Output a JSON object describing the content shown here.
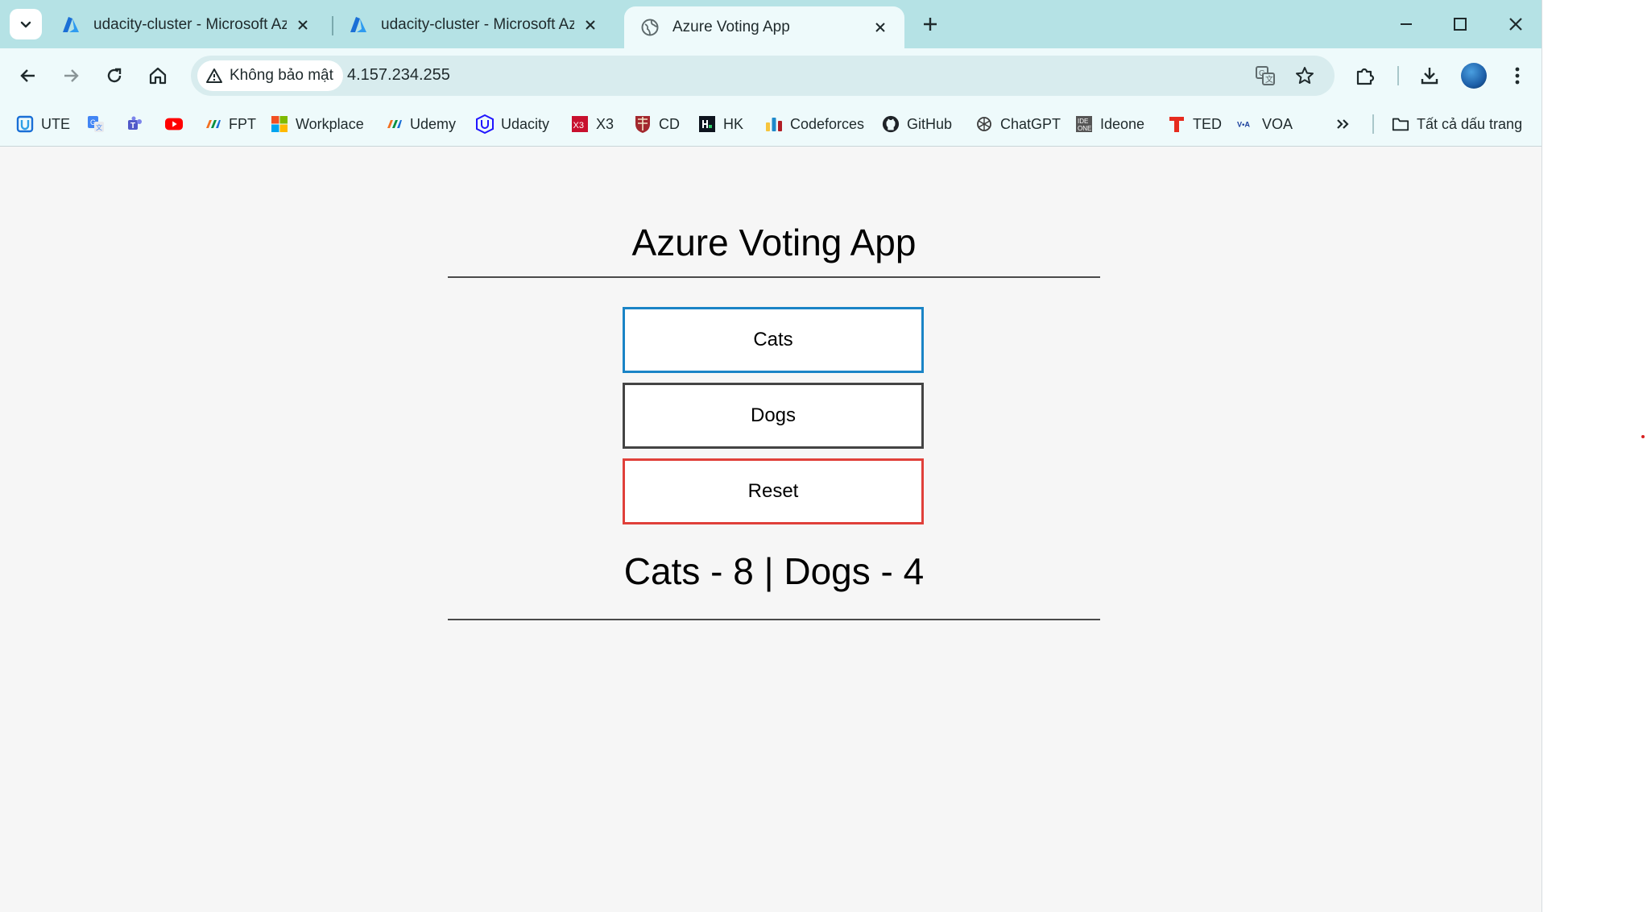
{
  "browser": {
    "tabs": [
      {
        "title": "udacity-cluster - Microsoft Azure",
        "icon": "azure-icon",
        "active": false
      },
      {
        "title": "udacity-cluster - Microsoft Azure",
        "icon": "azure-icon",
        "active": false
      },
      {
        "title": "Azure Voting App",
        "icon": "globe-icon",
        "active": true
      }
    ],
    "security_label": "Không bảo mật",
    "url": "4.157.234.255",
    "bookmarks": [
      {
        "label": "UTE",
        "icon": "ute-icon"
      },
      {
        "label": "",
        "icon": "google-translate-icon"
      },
      {
        "label": "",
        "icon": "teams-icon"
      },
      {
        "label": "",
        "icon": "youtube-icon"
      },
      {
        "label": "FPT",
        "icon": "fpt-icon"
      },
      {
        "label": "Workplace",
        "icon": "microsoft-icon"
      },
      {
        "label": "Udemy",
        "icon": "fpt-icon"
      },
      {
        "label": "Udacity",
        "icon": "udacity-icon"
      },
      {
        "label": "X3",
        "icon": "x3-icon"
      },
      {
        "label": "CD",
        "icon": "cambridge-icon"
      },
      {
        "label": "HK",
        "icon": "hackerrank-icon"
      },
      {
        "label": "Codeforces",
        "icon": "codeforces-icon"
      },
      {
        "label": "GitHub",
        "icon": "github-icon"
      },
      {
        "label": "ChatGPT",
        "icon": "chatgpt-icon"
      },
      {
        "label": "Ideone",
        "icon": "ideone-icon"
      },
      {
        "label": "TED",
        "icon": "ted-icon"
      },
      {
        "label": "VOA",
        "icon": "voa-icon"
      }
    ],
    "all_bookmarks_label": "Tất cả dấu trang",
    "colors": {
      "tabstrip": "#b5e2e5",
      "toolbar": "#eefafb",
      "omnibox": "#d8ecee"
    }
  },
  "app": {
    "title": "Azure Voting App",
    "buttons": {
      "cats": "Cats",
      "dogs": "Dogs",
      "reset": "Reset"
    },
    "button_colors": {
      "cats": "#1a84c6",
      "dogs": "#444444",
      "reset": "#e0403a"
    },
    "results": {
      "cats_label": "Cats",
      "cats_votes": 8,
      "dogs_label": "Dogs",
      "dogs_votes": 4,
      "text": "Cats - 8 | Dogs - 4"
    }
  }
}
